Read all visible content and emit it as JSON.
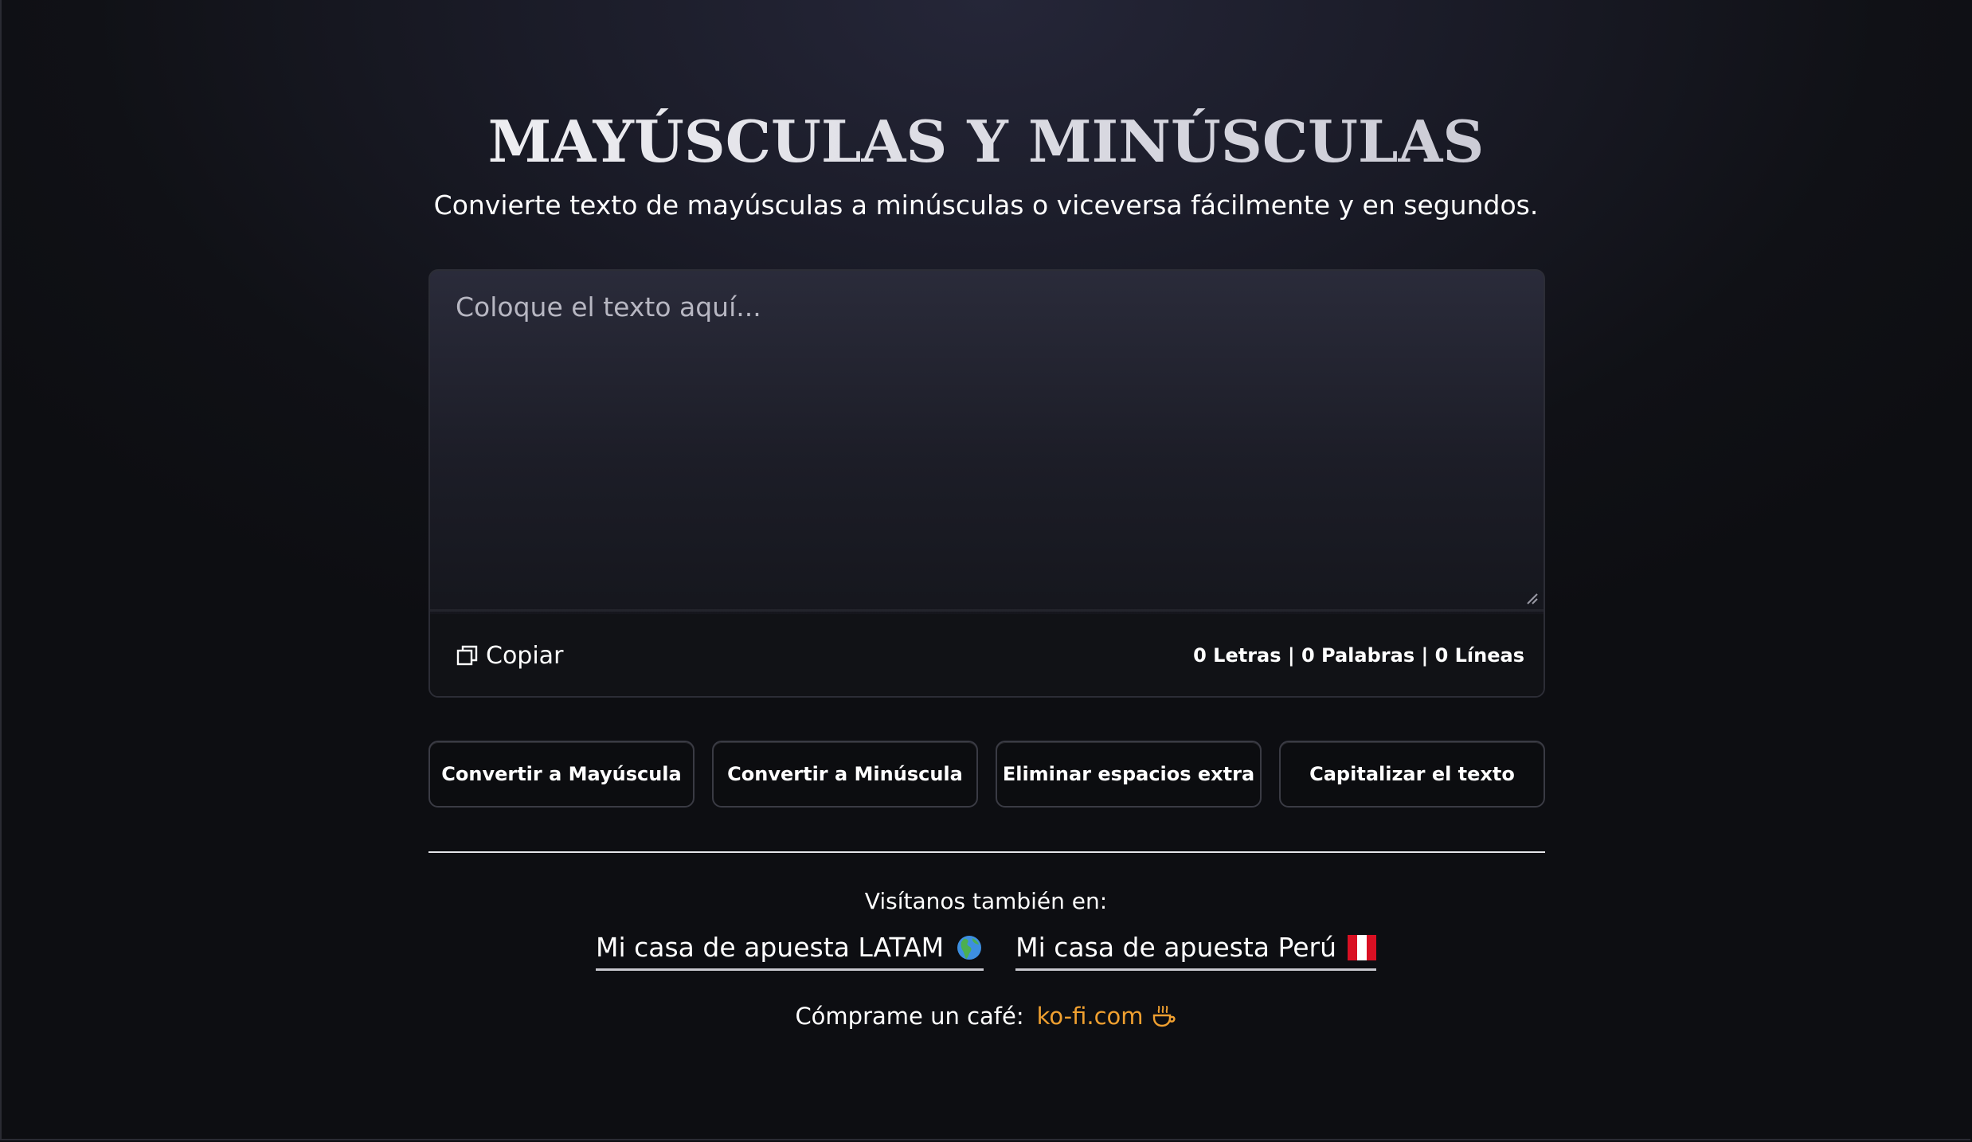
{
  "page": {
    "title": "MAYÚSCULAS Y MINÚSCULAS",
    "subtitle": "Convierte texto de mayúsculas a minúsculas o viceversa fácilmente y en segundos."
  },
  "editor": {
    "placeholder": "Coloque el texto aquí...",
    "value": "",
    "copy_label": "Copiar",
    "counts": "0 Letras | 0 Palabras | 0 Líneas"
  },
  "actions": [
    {
      "label": "Convertir a Mayúscula"
    },
    {
      "label": "Convertir a Minúscula"
    },
    {
      "label": "Eliminar espacios extra"
    },
    {
      "label": "Capitalizar el texto"
    }
  ],
  "footer": {
    "visit_label": "Visítanos también en:",
    "links": [
      {
        "label": "Mi casa de apuesta LATAM",
        "icon": "globe-americas-icon"
      },
      {
        "label": "Mi casa de apuesta Perú",
        "icon": "peru-flag-icon"
      }
    ],
    "coffee_label": "Cómprame un café:",
    "kofi_label": "ko-fi.com",
    "kofi_icon": "coffee-cup-icon",
    "kofi_color": "#f0a030"
  }
}
